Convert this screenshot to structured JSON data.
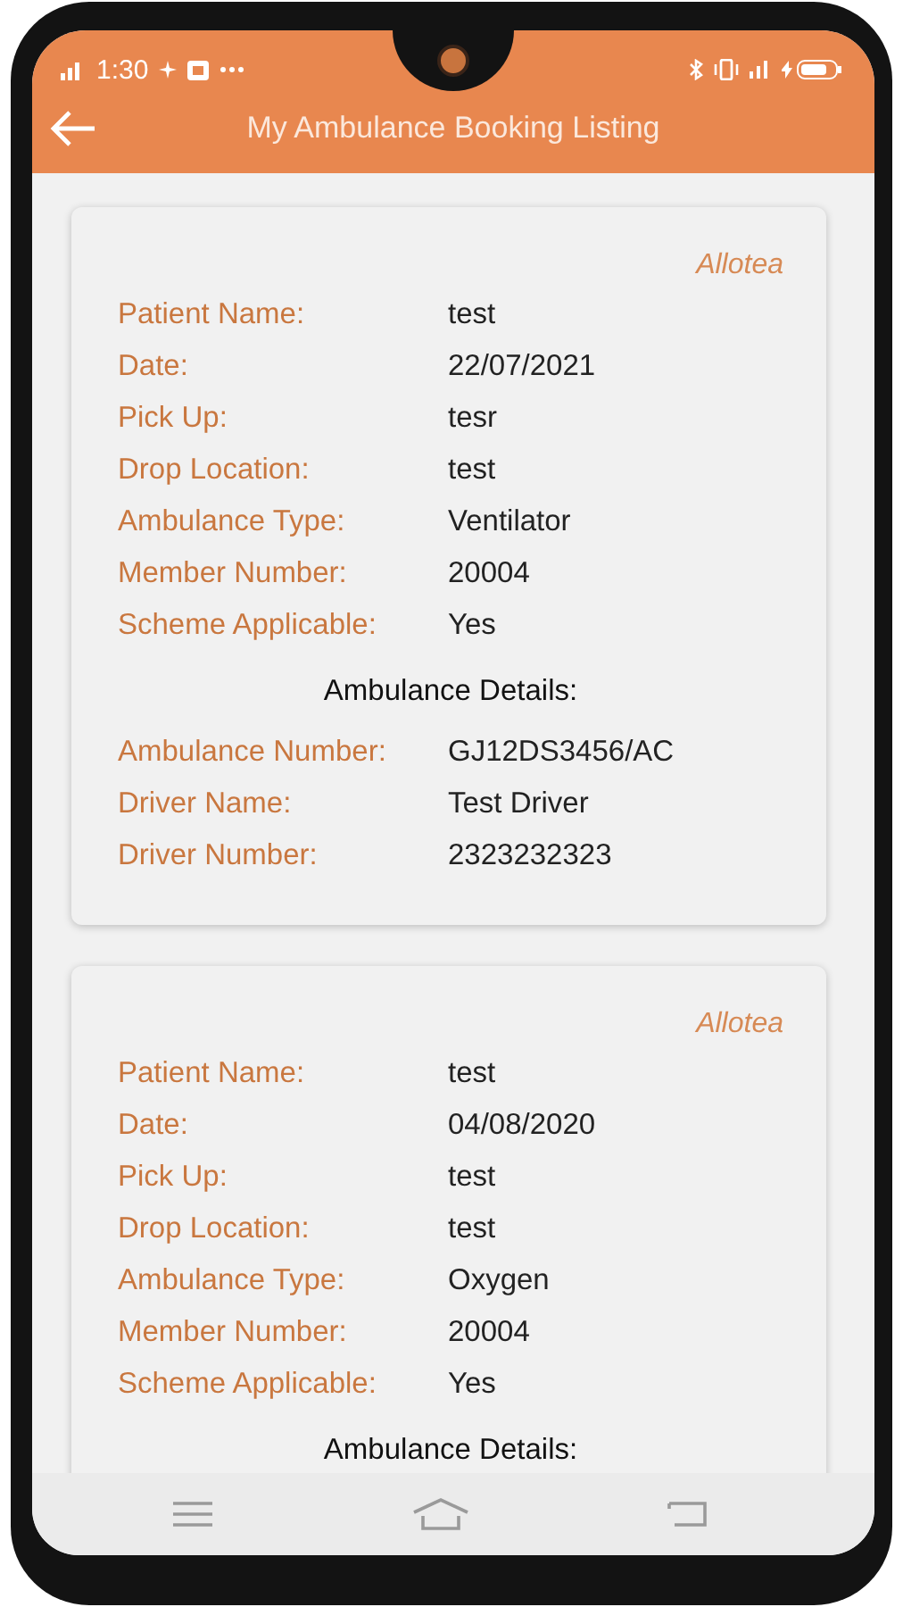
{
  "status_bar": {
    "time": "1:30"
  },
  "header": {
    "title": "My Ambulance Booking Listing"
  },
  "bookings": [
    {
      "status": "Allotea",
      "fields": [
        {
          "label": "Patient Name:",
          "value": "test"
        },
        {
          "label": "Date:",
          "value": "22/07/2021"
        },
        {
          "label": "Pick Up:",
          "value": "tesr"
        },
        {
          "label": "Drop Location:",
          "value": "test"
        },
        {
          "label": "Ambulance Type:",
          "value": "Ventilator"
        },
        {
          "label": "Member Number:",
          "value": "20004"
        },
        {
          "label": "Scheme Applicable:",
          "value": "Yes"
        }
      ],
      "details_heading": "Ambulance Details:",
      "details": [
        {
          "label": "Ambulance Number:",
          "value": "GJ12DS3456/AC"
        },
        {
          "label": "Driver Name:",
          "value": "Test Driver"
        },
        {
          "label": "Driver Number:",
          "value": "2323232323"
        }
      ]
    },
    {
      "status": "Allotea",
      "fields": [
        {
          "label": "Patient Name:",
          "value": "test"
        },
        {
          "label": "Date:",
          "value": "04/08/2020"
        },
        {
          "label": "Pick Up:",
          "value": "test"
        },
        {
          "label": "Drop Location:",
          "value": "test"
        },
        {
          "label": "Ambulance Type:",
          "value": "Oxygen"
        },
        {
          "label": "Member Number:",
          "value": "20004"
        },
        {
          "label": "Scheme Applicable:",
          "value": "Yes"
        }
      ],
      "details_heading": "Ambulance Details:"
    }
  ]
}
